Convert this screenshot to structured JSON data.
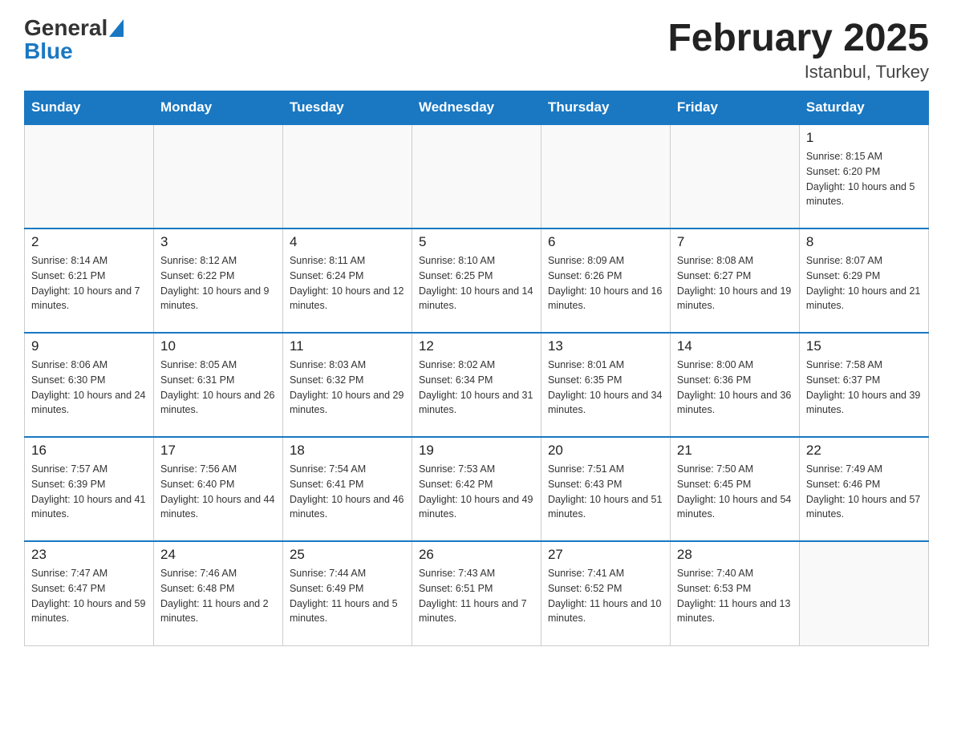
{
  "header": {
    "logo_general": "General",
    "logo_blue": "Blue",
    "title": "February 2025",
    "subtitle": "Istanbul, Turkey"
  },
  "days_of_week": [
    "Sunday",
    "Monday",
    "Tuesday",
    "Wednesday",
    "Thursday",
    "Friday",
    "Saturday"
  ],
  "weeks": [
    [
      {
        "day": "",
        "info": ""
      },
      {
        "day": "",
        "info": ""
      },
      {
        "day": "",
        "info": ""
      },
      {
        "day": "",
        "info": ""
      },
      {
        "day": "",
        "info": ""
      },
      {
        "day": "",
        "info": ""
      },
      {
        "day": "1",
        "info": "Sunrise: 8:15 AM\nSunset: 6:20 PM\nDaylight: 10 hours and 5 minutes."
      }
    ],
    [
      {
        "day": "2",
        "info": "Sunrise: 8:14 AM\nSunset: 6:21 PM\nDaylight: 10 hours and 7 minutes."
      },
      {
        "day": "3",
        "info": "Sunrise: 8:12 AM\nSunset: 6:22 PM\nDaylight: 10 hours and 9 minutes."
      },
      {
        "day": "4",
        "info": "Sunrise: 8:11 AM\nSunset: 6:24 PM\nDaylight: 10 hours and 12 minutes."
      },
      {
        "day": "5",
        "info": "Sunrise: 8:10 AM\nSunset: 6:25 PM\nDaylight: 10 hours and 14 minutes."
      },
      {
        "day": "6",
        "info": "Sunrise: 8:09 AM\nSunset: 6:26 PM\nDaylight: 10 hours and 16 minutes."
      },
      {
        "day": "7",
        "info": "Sunrise: 8:08 AM\nSunset: 6:27 PM\nDaylight: 10 hours and 19 minutes."
      },
      {
        "day": "8",
        "info": "Sunrise: 8:07 AM\nSunset: 6:29 PM\nDaylight: 10 hours and 21 minutes."
      }
    ],
    [
      {
        "day": "9",
        "info": "Sunrise: 8:06 AM\nSunset: 6:30 PM\nDaylight: 10 hours and 24 minutes."
      },
      {
        "day": "10",
        "info": "Sunrise: 8:05 AM\nSunset: 6:31 PM\nDaylight: 10 hours and 26 minutes."
      },
      {
        "day": "11",
        "info": "Sunrise: 8:03 AM\nSunset: 6:32 PM\nDaylight: 10 hours and 29 minutes."
      },
      {
        "day": "12",
        "info": "Sunrise: 8:02 AM\nSunset: 6:34 PM\nDaylight: 10 hours and 31 minutes."
      },
      {
        "day": "13",
        "info": "Sunrise: 8:01 AM\nSunset: 6:35 PM\nDaylight: 10 hours and 34 minutes."
      },
      {
        "day": "14",
        "info": "Sunrise: 8:00 AM\nSunset: 6:36 PM\nDaylight: 10 hours and 36 minutes."
      },
      {
        "day": "15",
        "info": "Sunrise: 7:58 AM\nSunset: 6:37 PM\nDaylight: 10 hours and 39 minutes."
      }
    ],
    [
      {
        "day": "16",
        "info": "Sunrise: 7:57 AM\nSunset: 6:39 PM\nDaylight: 10 hours and 41 minutes."
      },
      {
        "day": "17",
        "info": "Sunrise: 7:56 AM\nSunset: 6:40 PM\nDaylight: 10 hours and 44 minutes."
      },
      {
        "day": "18",
        "info": "Sunrise: 7:54 AM\nSunset: 6:41 PM\nDaylight: 10 hours and 46 minutes."
      },
      {
        "day": "19",
        "info": "Sunrise: 7:53 AM\nSunset: 6:42 PM\nDaylight: 10 hours and 49 minutes."
      },
      {
        "day": "20",
        "info": "Sunrise: 7:51 AM\nSunset: 6:43 PM\nDaylight: 10 hours and 51 minutes."
      },
      {
        "day": "21",
        "info": "Sunrise: 7:50 AM\nSunset: 6:45 PM\nDaylight: 10 hours and 54 minutes."
      },
      {
        "day": "22",
        "info": "Sunrise: 7:49 AM\nSunset: 6:46 PM\nDaylight: 10 hours and 57 minutes."
      }
    ],
    [
      {
        "day": "23",
        "info": "Sunrise: 7:47 AM\nSunset: 6:47 PM\nDaylight: 10 hours and 59 minutes."
      },
      {
        "day": "24",
        "info": "Sunrise: 7:46 AM\nSunset: 6:48 PM\nDaylight: 11 hours and 2 minutes."
      },
      {
        "day": "25",
        "info": "Sunrise: 7:44 AM\nSunset: 6:49 PM\nDaylight: 11 hours and 5 minutes."
      },
      {
        "day": "26",
        "info": "Sunrise: 7:43 AM\nSunset: 6:51 PM\nDaylight: 11 hours and 7 minutes."
      },
      {
        "day": "27",
        "info": "Sunrise: 7:41 AM\nSunset: 6:52 PM\nDaylight: 11 hours and 10 minutes."
      },
      {
        "day": "28",
        "info": "Sunrise: 7:40 AM\nSunset: 6:53 PM\nDaylight: 11 hours and 13 minutes."
      },
      {
        "day": "",
        "info": ""
      }
    ]
  ]
}
